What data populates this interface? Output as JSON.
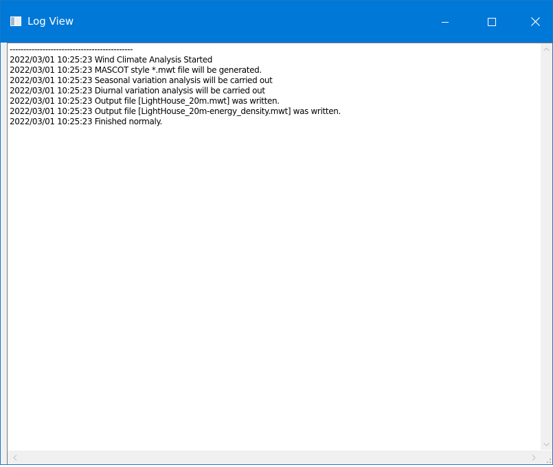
{
  "window": {
    "title": "Log View",
    "app_icon": "window-app-icon",
    "controls": {
      "minimize_icon": "minimize-icon",
      "maximize_icon": "maximize-icon",
      "close_icon": "close-icon"
    },
    "accent_color": "#0078d7"
  },
  "log": {
    "lines": [
      "---------------------------------------------",
      "2022/03/01 10:25:23 Wind Climate Analysis Started",
      "2022/03/01 10:25:23 MASCOT style *.mwt file will be generated.",
      "2022/03/01 10:25:23 Seasonal variation analysis will be carried out",
      "2022/03/01 10:25:23 Diurnal variation analysis will be carried out",
      "2022/03/01 10:25:23 Output file [LightHouse_20m.mwt] was written.",
      "2022/03/01 10:25:23 Output file [LightHouse_20m-energy_density.mwt] was written.",
      "2022/03/01 10:25:23 Finished normaly."
    ]
  },
  "scrollbars": {
    "vertical": {
      "up_icon": "chevron-up-icon",
      "down_icon": "chevron-down-icon"
    },
    "horizontal": {
      "left_icon": "chevron-left-icon",
      "right_icon": "chevron-right-icon"
    }
  }
}
